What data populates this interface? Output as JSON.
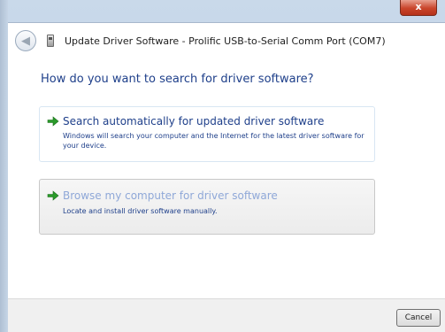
{
  "window": {
    "title": "Update Driver Software - Prolific USB-to-Serial Comm Port (COM7)",
    "close_glyph": "x"
  },
  "titlebar": {
    "back_glyph": "◀"
  },
  "heading": "How do you want to search for driver software?",
  "options": [
    {
      "title": "Search automatically for updated driver software",
      "description": "Windows will search your computer and the Internet for the latest driver software for your device."
    },
    {
      "title": "Browse my computer for driver software",
      "description": "Locate and install driver software manually."
    }
  ],
  "footer": {
    "cancel_label": "Cancel"
  },
  "colors": {
    "accent_blue": "#1e3f8a",
    "arrow_green": "#2a9a2a",
    "disabled_link": "#8fa8d8"
  },
  "icons": [
    "back-arrow-icon",
    "device-icon",
    "green-arrow-icon",
    "close-icon"
  ]
}
